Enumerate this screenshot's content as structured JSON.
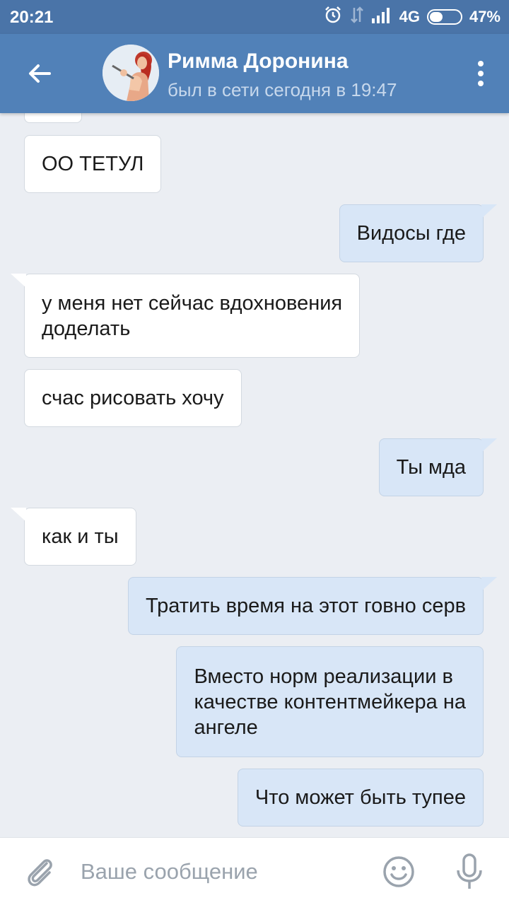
{
  "status_bar": {
    "time": "20:21",
    "network": "4G",
    "battery_percent": "47%",
    "battery_level": 0.47,
    "icons": [
      "alarm-icon",
      "data-transfer-icon",
      "signal-icon",
      "battery-icon"
    ]
  },
  "header": {
    "back_icon": "arrow-left-icon",
    "contact_name": "Римма Доронина",
    "contact_status": "был в сети сегодня в 19:47",
    "menu_icon": "more-vertical-icon"
  },
  "messages": [
    {
      "direction": "in",
      "text": ""
    },
    {
      "direction": "in",
      "text": "ОО ТЕТУЛ"
    },
    {
      "direction": "out",
      "text": "Видосы где"
    },
    {
      "direction": "in",
      "text": "у меня нет сейчас вдохновения\nдоделать"
    },
    {
      "direction": "in",
      "text": "счас рисовать хочу"
    },
    {
      "direction": "out",
      "text": "Ты мда"
    },
    {
      "direction": "in",
      "text": "как и ты"
    },
    {
      "direction": "out",
      "text": "Тратить время на этот говно серв"
    },
    {
      "direction": "out",
      "text": "Вместо норм реализации в\nкачестве контентмейкера на\nангеле"
    },
    {
      "direction": "out",
      "text": "Что может быть тупее"
    }
  ],
  "input_bar": {
    "placeholder": "Ваше сообщение",
    "value": "",
    "attach_icon": "paperclip-icon",
    "emoji_icon": "smile-icon",
    "mic_icon": "microphone-icon"
  },
  "colors": {
    "status_bar": "#4a74a8",
    "header": "#5181b8",
    "background": "#ebeef3",
    "incoming_bubble": "#ffffff",
    "outgoing_bubble": "#d8e6f7",
    "icon_gray": "#9aa3ad"
  }
}
